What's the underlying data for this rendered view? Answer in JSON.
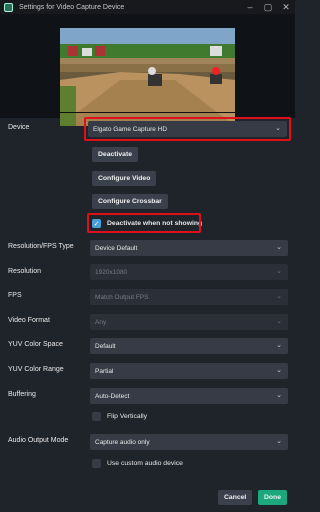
{
  "window": {
    "title": "Settings for Video Capture Device"
  },
  "fields": {
    "device_label": "Device",
    "device_value": "Elgato Game Capture HD",
    "deactivate_button": "Deactivate",
    "configure_video_button": "Configure Video",
    "configure_crossbar_button": "Configure Crossbar",
    "deactivate_when_not_showing": "Deactivate when not showing",
    "resolution_fps_type_label": "Resolution/FPS Type",
    "resolution_fps_type_value": "Device Default",
    "resolution_label": "Resolution",
    "resolution_value": "1920x1080",
    "fps_label": "FPS",
    "fps_value": "Match Output FPS",
    "video_format_label": "Video Format",
    "video_format_value": "Any",
    "yuv_color_space_label": "YUV Color Space",
    "yuv_color_space_value": "Default",
    "yuv_color_range_label": "YUV Color Range",
    "yuv_color_range_value": "Partial",
    "buffering_label": "Buffering",
    "buffering_value": "Auto-Detect",
    "flip_vertically": "Flip Vertically",
    "audio_output_mode_label": "Audio Output Mode",
    "audio_output_mode_value": "Capture audio only",
    "use_custom_audio_device": "Use custom audio device"
  },
  "footer": {
    "cancel": "Cancel",
    "done": "Done"
  },
  "colors": {
    "accent": "#1aa87c",
    "highlight": "#e0101a",
    "checkbox_checked": "#4aa0d6"
  }
}
